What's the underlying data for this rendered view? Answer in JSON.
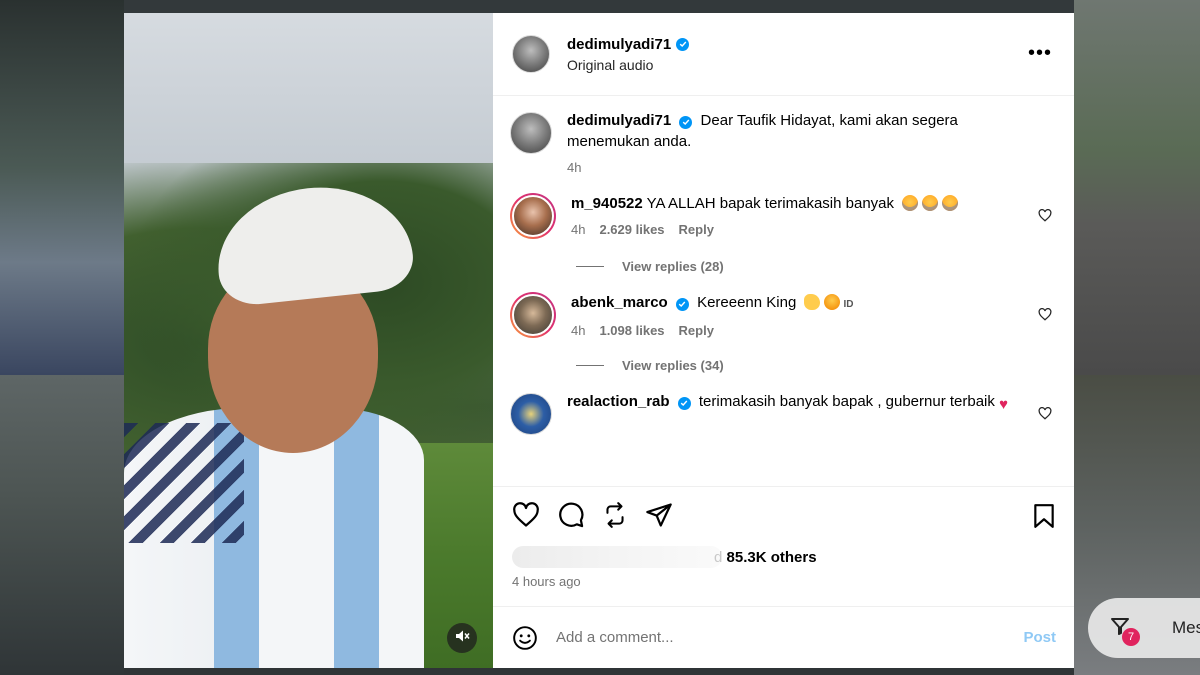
{
  "post": {
    "author": "dedimulyadi71",
    "audio": "Original audio",
    "more_label": "•••"
  },
  "caption": {
    "author": "dedimulyadi71",
    "text": "Dear Taufik Hidayat, kami akan segera menemukan anda.",
    "time": "4h"
  },
  "comments": [
    {
      "user": "m_940522",
      "verified": false,
      "text": "YA ALLAH bapak terimakasih banyak",
      "emojis": [
        "crying-face-emoji",
        "crying-face-emoji",
        "crying-face-emoji"
      ],
      "time": "4h",
      "likes": "2.629 likes",
      "reply": "Reply",
      "view_replies": "View replies (28)"
    },
    {
      "user": "abenk_marco",
      "verified": true,
      "text": "Kereeenn King",
      "emojis": [
        "clapping-emoji",
        "hot-face-emoji"
      ],
      "tag": "ID",
      "time": "4h",
      "likes": "1.098 likes",
      "reply": "Reply",
      "view_replies": "View replies (34)"
    },
    {
      "user": "realaction_rab",
      "verified": true,
      "text": "terimakasih banyak bapak , gubernur terbaik",
      "heart": "♥"
    }
  ],
  "likes": {
    "prefix": "d",
    "count": "85.3K others"
  },
  "timestamp": "4 hours ago",
  "composer": {
    "placeholder": "Add a comment...",
    "post_label": "Post"
  },
  "messages_button": {
    "label": "Messa",
    "badge": "7"
  },
  "colors": {
    "verified": "#0095f6",
    "post_disabled": "#8fc9f5",
    "heart": "#e0245e"
  }
}
